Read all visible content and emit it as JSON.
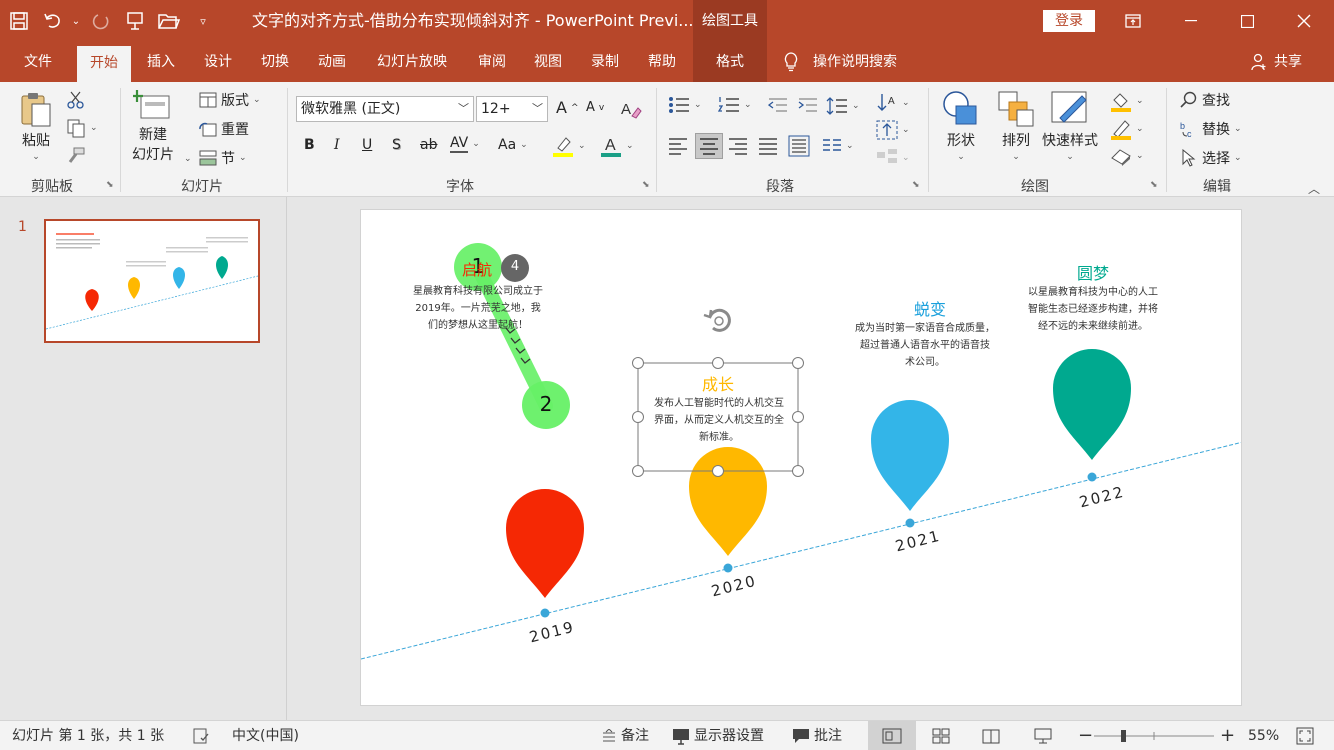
{
  "window": {
    "title": "文字的对齐方式-借助分布实现倾斜对齐  -  PowerPoint Previ...",
    "context_title": "绘图工具",
    "login": "登录"
  },
  "tabs": [
    "文件",
    "开始",
    "插入",
    "设计",
    "切换",
    "动画",
    "幻灯片放映",
    "审阅",
    "视图",
    "录制",
    "帮助",
    "格式"
  ],
  "active_tab": "开始",
  "tell_me": "操作说明搜索",
  "share": "共享",
  "ribbon": {
    "clipboard": {
      "paste": "粘贴",
      "label": "剪贴板"
    },
    "slides": {
      "new_slide_1": "新建",
      "new_slide_2": "幻灯片",
      "layout": "版式",
      "reset": "重置",
      "section": "节",
      "label": "幻灯片"
    },
    "font": {
      "font_name": "微软雅黑 (正文)",
      "font_size": "12+",
      "bold": "B",
      "italic": "I",
      "underline": "U",
      "shadow": "S",
      "strike": "ab",
      "spacing": "AV",
      "case": "Aa",
      "grow": "A",
      "shrink": "A",
      "highlight": "A",
      "color": "A",
      "label": "字体"
    },
    "paragraph": {
      "label": "段落"
    },
    "drawing": {
      "shapes": "形状",
      "arrange": "排列",
      "quick_styles": "快速样式",
      "label": "绘图"
    },
    "editing": {
      "find": "查找",
      "replace": "替换",
      "select": "选择",
      "label": "编辑"
    }
  },
  "thumbnail": {
    "slide_number": "1"
  },
  "slide": {
    "milestones": [
      {
        "title": "启航",
        "desc": "星晨教育科技有限公司成立于\n2019年。一片荒芜之地，我\n们的梦想从这里起航！",
        "year": "2019",
        "color": "#f52804",
        "title_color": "#f52804"
      },
      {
        "title": "成长",
        "desc": "发布人工智能时代的人机交互\n界面，从而定义人机交互的全\n新标准。",
        "year": "2020",
        "color": "#ffb800",
        "title_color": "#ffb800"
      },
      {
        "title": "蜕变",
        "desc": "成为当时第一家语音合成质量，\n超过普通人语音水平的语音技\n术公司。",
        "year": "2021",
        "color": "#33b5e8",
        "title_color": "#1aa0dc"
      },
      {
        "title": "圆梦",
        "desc": "以星晨教育科技为中心的人工\n智能生态已经逐步构建，并将\n经不远的未来继续前进。",
        "year": "2022",
        "color": "#00a98f",
        "title_color": "#00a98f"
      }
    ],
    "annotations": {
      "start": "1",
      "end": "2",
      "badge": "4"
    }
  },
  "status": {
    "slide_info": "幻灯片 第 1 张，共 1 张",
    "language": "中文(中国)",
    "notes": "备注",
    "display": "显示器设置",
    "comments": "批注",
    "zoom": "55%"
  },
  "colors": {
    "accent": "#b7472a",
    "timeline": "#3aa6d8"
  }
}
